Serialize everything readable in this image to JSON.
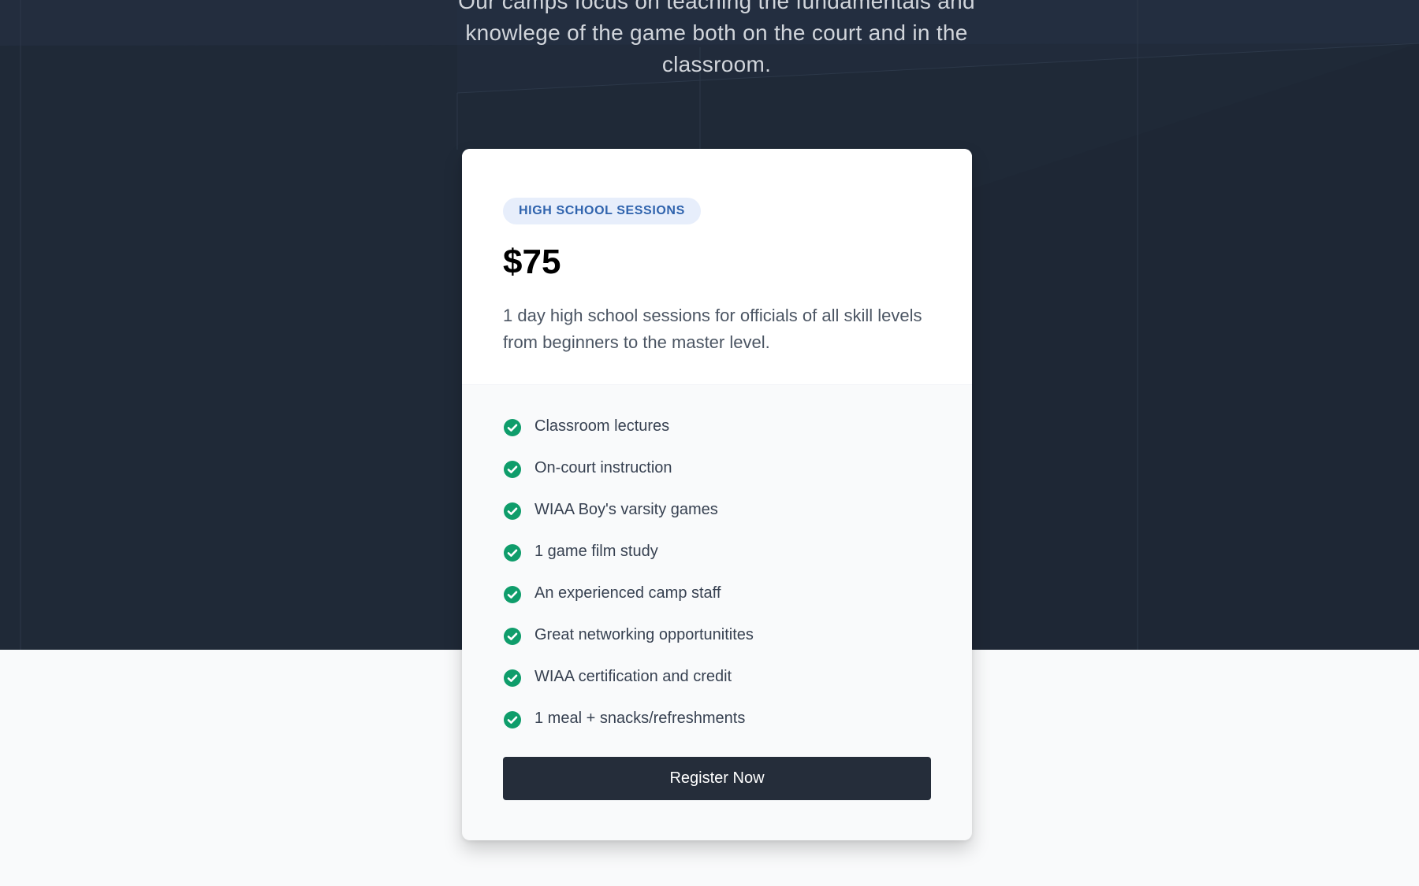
{
  "intro": {
    "text": "Our camps focus on teaching the fundamentals and knowlege of the game both on the court and in the classroom."
  },
  "pricing_card": {
    "badge": "HIGH SCHOOL SESSIONS",
    "price": "$75",
    "description": "1 day high school sessions for officials of all skill levels from beginners to the master level.",
    "features": [
      {
        "label": "Classroom lectures",
        "icon": "check-circle-icon"
      },
      {
        "label": "On-court instruction",
        "icon": "check-circle-icon"
      },
      {
        "label": "WIAA Boy's varsity games",
        "icon": "check-circle-icon"
      },
      {
        "label": "1 game film study",
        "icon": "check-circle-icon"
      },
      {
        "label": "An experienced camp staff",
        "icon": "check-circle-icon"
      },
      {
        "label": "Great networking opportunitites",
        "icon": "check-circle-icon"
      },
      {
        "label": "WIAA certification and credit",
        "icon": "check-circle-icon"
      },
      {
        "label": "1 meal + snacks/refreshments",
        "icon": "check-circle-icon"
      }
    ],
    "register_label": "Register Now"
  },
  "colors": {
    "hero_background": "#1f2937",
    "page_background": "#f9fafb",
    "check_green": "#0f9d6b",
    "badge_text": "#2f63ad",
    "badge_background": "#e7eefb",
    "button_background": "#252d3a"
  }
}
